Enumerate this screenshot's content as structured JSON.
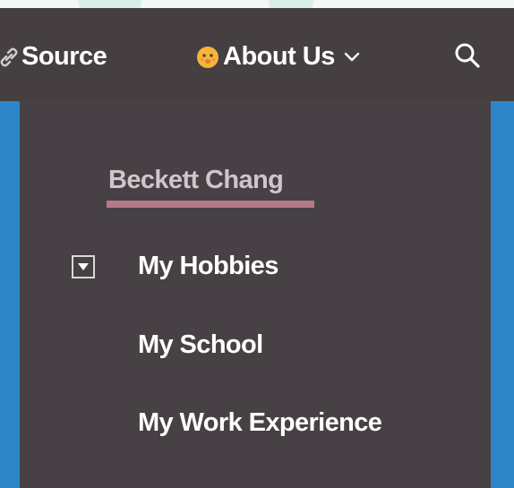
{
  "nav": {
    "source_label": "Source",
    "about_label": "About Us",
    "icons": {
      "source": "link-icon",
      "about": "face-emoji-icon",
      "about_chevron": "chevron-down-icon",
      "search": "search-icon"
    }
  },
  "dropdown": {
    "title": "Beckett Chang",
    "items": [
      {
        "label": "My Hobbies",
        "has_toggle": true,
        "toggle_icon": "caret-down-box-icon"
      },
      {
        "label": "My School"
      },
      {
        "label": "My Work Experience"
      }
    ]
  },
  "colors": {
    "navbar_bg": "#453f42",
    "dropdown_bg": "#474044",
    "side_strip": "#2e86c8",
    "title_text": "#cfc5cb",
    "title_underline": "#b47a88",
    "item_text": "#ffffff"
  }
}
